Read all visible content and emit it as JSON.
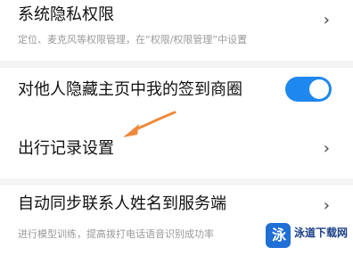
{
  "settings": {
    "privacy": {
      "title": "系统隐私权限",
      "subtitle": "定位、麦克风等权限管理，在“权限/权限管理”中设置",
      "chevron": "›"
    },
    "hide_checkins": {
      "title": "对他人隐藏主页中我的签到商圈",
      "enabled": true
    },
    "travel_record": {
      "title": "出行记录设置",
      "chevron": "›"
    },
    "sync_contacts": {
      "title": "自动同步联系人姓名到服务端",
      "subtitle": "进行模型训练，提高拨打电话语音识别成功率",
      "chevron": "›"
    }
  },
  "watermark": {
    "name": "泳道下载网",
    "logo_glyph": "泳"
  },
  "annotation": {
    "arrow_color": "#ef8a3c",
    "arrow_icon": "pointer-arrow-icon"
  },
  "colors": {
    "toggle_on": "#1f87f0",
    "divider": "#f4f4f4"
  }
}
